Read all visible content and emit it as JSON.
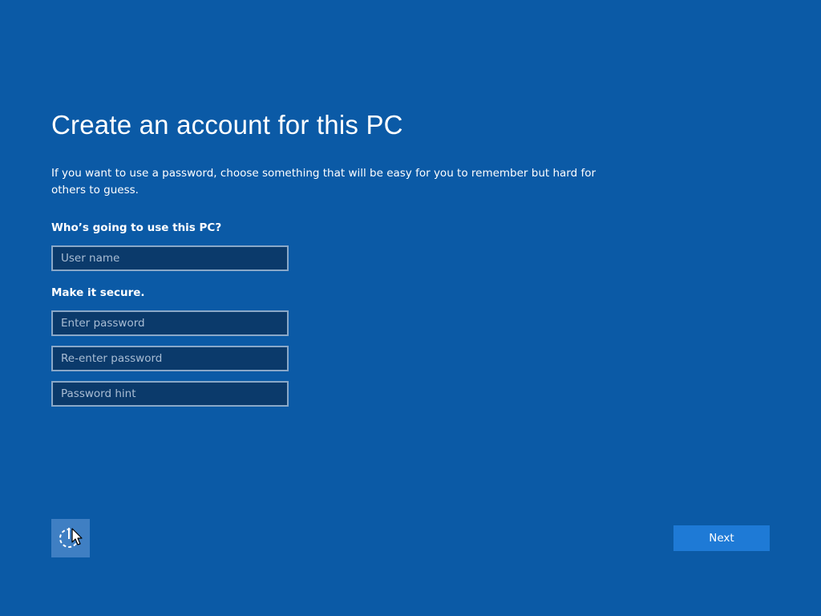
{
  "header": {
    "title": "Create an account for this PC"
  },
  "main": {
    "description": "If you want to use a password, choose something that will be easy for you to remember but hard for others to guess.",
    "user_section": {
      "label": "Who’s going to use this PC?",
      "username_placeholder": "User name",
      "username_value": ""
    },
    "security_section": {
      "label": "Make it secure.",
      "password_placeholder": "Enter password",
      "password_value": "",
      "reenter_placeholder": "Re-enter password",
      "reenter_value": "",
      "hint_placeholder": "Password hint",
      "hint_value": ""
    }
  },
  "footer": {
    "ease_of_access_icon": "ease-of-access-icon",
    "next_label": "Next"
  },
  "colors": {
    "background": "#0b5aa6",
    "field_background": "#0b3a6b",
    "field_border": "#8aa8c8",
    "primary_button": "#1e7ad6",
    "icon_button": "#3f7fc3"
  }
}
